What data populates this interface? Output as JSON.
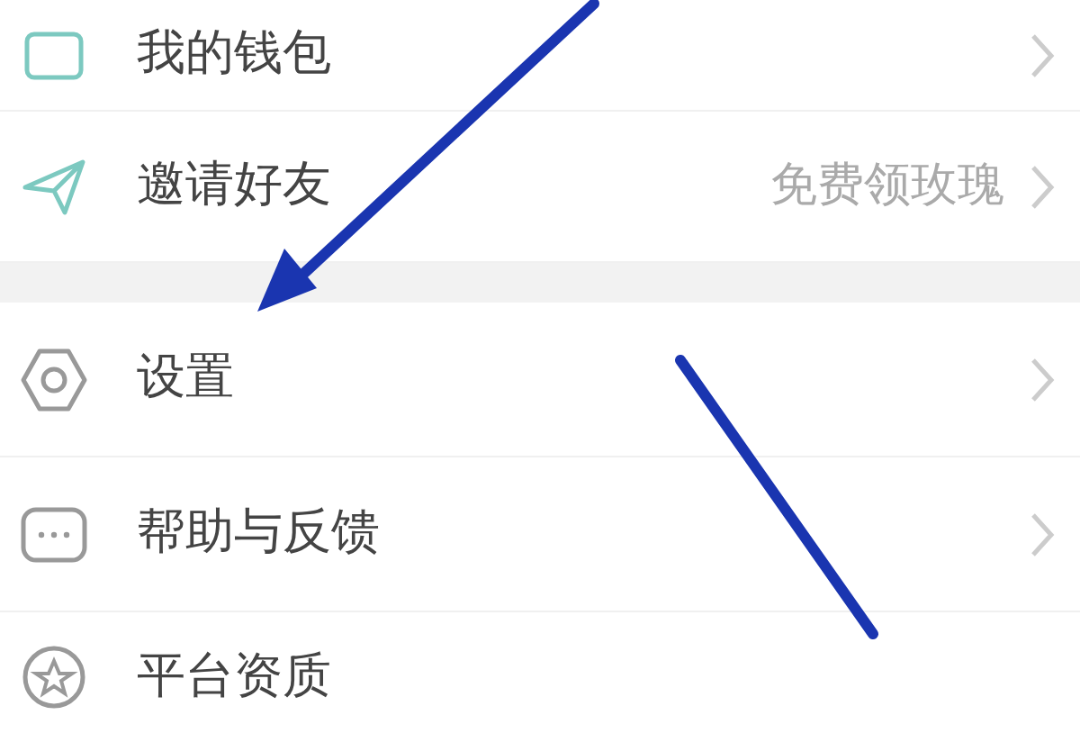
{
  "sections": [
    {
      "items": [
        {
          "label": "我的钱包",
          "chevron": true
        },
        {
          "label": "邀请好友",
          "detail": "免费领玫瑰",
          "chevron": true
        }
      ]
    },
    {
      "items": [
        {
          "label": "设置",
          "chevron": true
        },
        {
          "label": "帮助与反馈",
          "chevron": true
        },
        {
          "label": "平台资质",
          "chevron": false
        }
      ]
    }
  ]
}
